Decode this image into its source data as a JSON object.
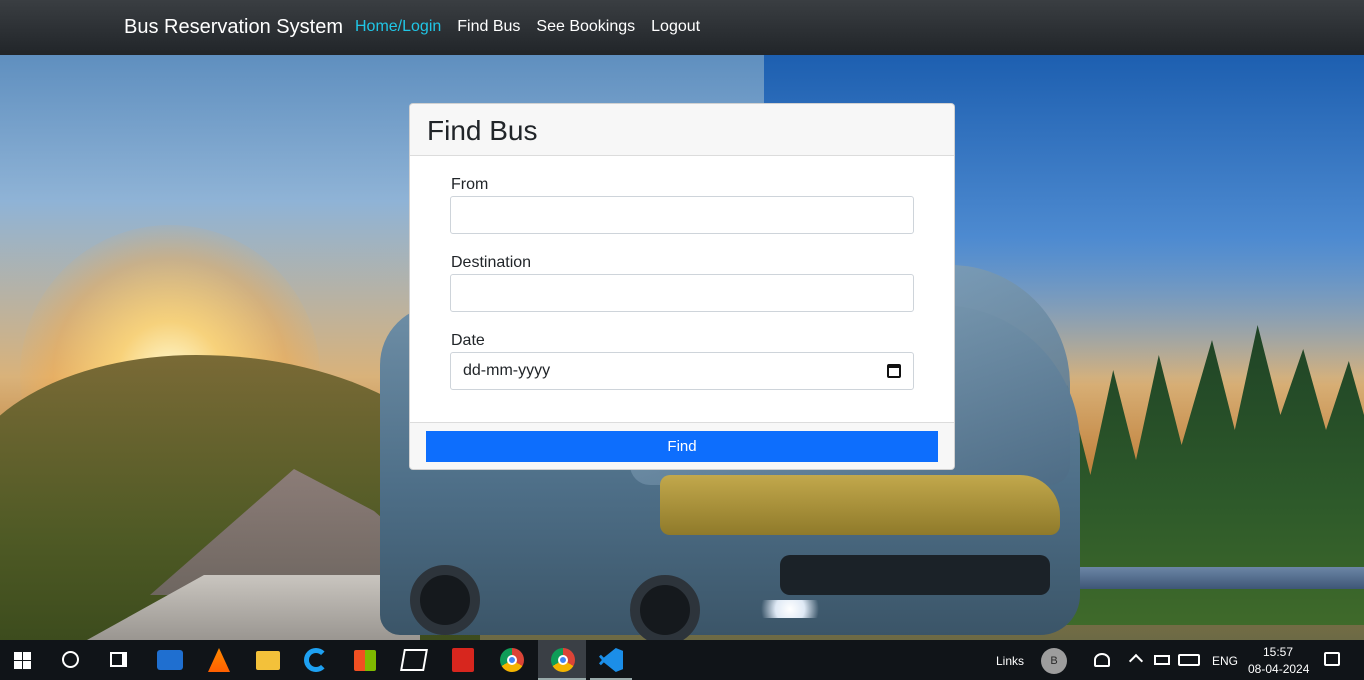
{
  "navbar": {
    "brand": "Bus Reservation System",
    "links": [
      {
        "label": "Home/Login",
        "active": true
      },
      {
        "label": "Find Bus",
        "active": false
      },
      {
        "label": "See Bookings",
        "active": false
      },
      {
        "label": "Logout",
        "active": false
      }
    ],
    "active_color": "#20c6e6"
  },
  "card": {
    "title": "Find Bus",
    "fields": {
      "from": {
        "label": "From",
        "value": ""
      },
      "destination": {
        "label": "Destination",
        "value": ""
      },
      "date": {
        "label": "Date",
        "placeholder": "dd-mm-yyyy"
      }
    },
    "button_label": "Find",
    "button_color": "#0d6efd"
  },
  "taskbar": {
    "apps": [
      "windows-icon",
      "search-icon",
      "task-view-icon",
      "mail-icon",
      "vlc-icon",
      "file-explorer-icon",
      "internet-explorer-icon",
      "store-icon",
      "files-icon",
      "acrobat-pdf-icon",
      "chrome-icon",
      "chrome-profile-icon",
      "vscode-icon"
    ],
    "links_label": "Links",
    "avatar_letter": "B",
    "language": "ENG",
    "time": "15:57",
    "date": "08-04-2024"
  }
}
